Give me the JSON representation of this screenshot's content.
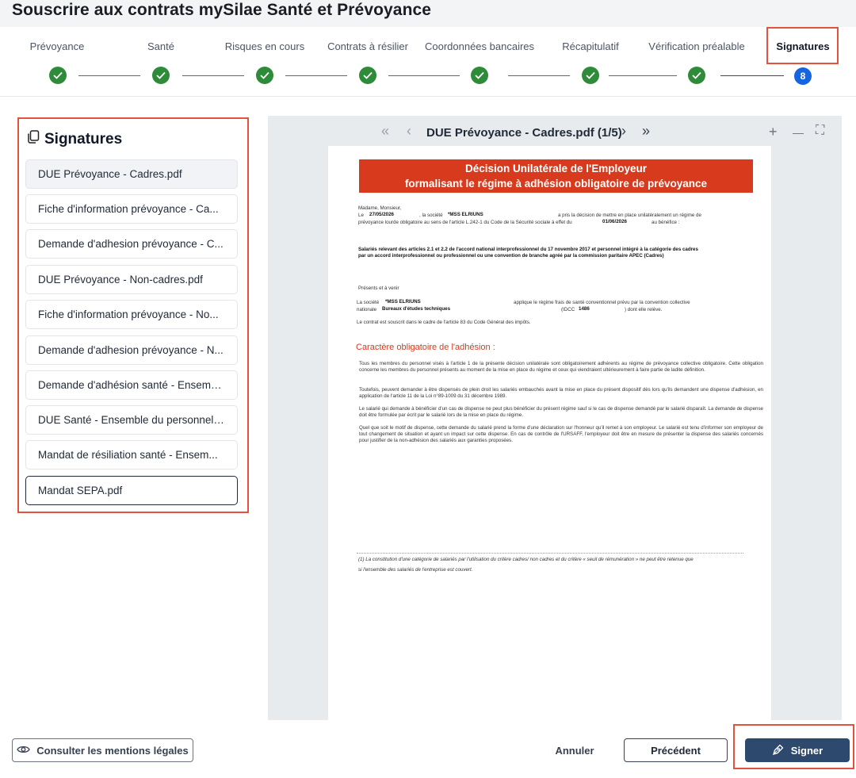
{
  "page_title": "Souscrire aux contrats mySilae Santé et Prévoyance",
  "stepper": {
    "steps": [
      {
        "label": "Prévoyance",
        "status": "done"
      },
      {
        "label": "Santé",
        "status": "done"
      },
      {
        "label": "Risques en cours",
        "status": "done"
      },
      {
        "label": "Contrats à résilier",
        "status": "done"
      },
      {
        "label": "Coordonnées bancaires",
        "status": "done"
      },
      {
        "label": "Récapitulatif",
        "status": "done"
      },
      {
        "label": "Vérification préalable",
        "status": "done"
      },
      {
        "label": "Signatures",
        "status": "active",
        "number": "8"
      }
    ]
  },
  "sidebar": {
    "title": "Signatures",
    "icon": "copy-icon",
    "documents": [
      "DUE Prévoyance - Cadres.pdf",
      "Fiche d'information prévoyance - Ca...",
      "Demande d'adhesion prévoyance - C...",
      "DUE Prévoyance - Non-cadres.pdf",
      "Fiche d'information prévoyance - No...",
      "Demande d'adhesion prévoyance - N...",
      "Demande d'adhésion santé - Ensemb...",
      "DUE Santé - Ensemble du personnel....",
      "Mandat de résiliation santé - Ensem...",
      "Mandat SEPA.pdf"
    ]
  },
  "viewer": {
    "title": "DUE Prévoyance - Cadres.pdf (1/5)",
    "first_icon": "«",
    "prev_icon": "‹",
    "next_icon": "›",
    "last_icon": "»",
    "zoom_in": "+",
    "zoom_out": "—",
    "fullscreen": "⛶"
  },
  "document": {
    "banner_line1": "Décision Unilatérale de l'Employeur",
    "banner_line2": "formalisant le régime à adhésion obligatoire de prévoyance",
    "salutation": "Madame, Monsieur,",
    "line_le": "Le",
    "date1": "27/05/2026",
    "la_societe": ", la société",
    "company": "*MSS ELRIUNS",
    "decision_text": "a pris la décision de mettre en place unilatéralement un régime de",
    "decision_text2": "prévoyance lourde obligatoire au sens de l'article L.242-1 du Code de la Sécurité sociale à effet du",
    "date2": "01/06/2026",
    "au_benefice": "au bénéfice :",
    "salaries_line1": "Salariés relevant des articles 2.1 et 2.2 de l'accord national interprofessionnel du 17 novembre 2017 et personnel intégré à la catégorie des cadres",
    "salaries_line2": "par un accord interprofessionnel ou professionnel ou une convention de branche agréé par la commission paritaire APEC (Cadres)",
    "presents": "Présents et à venir",
    "societe_label": "La société",
    "applique_text": "applique le régime frais de santé conventionnel prévu par la convention collective",
    "nationale": "nationale",
    "bureau": "Bureaux d'études techniques",
    "idcc_label": "(IDCC",
    "idcc": "1486",
    "releve": ") dont elle relève.",
    "contrat_text": "Le contrat est souscrit dans le cadre de l'article 83 du Code Général des impôts.",
    "caractere_title": "Caractère obligatoire de l'adhésion :",
    "para1": "Tous les membres du personnel visés à l'article 1 de la présente décision unilatérale sont obligatoirement adhérents au régime de prévoyance collective obligatoire. Cette obligation concerne les membres du personnel présents au moment de la mise en place du régime et ceux qui viendraient ultérieurement à faire partie de ladite définition.",
    "para2": "Toutefois, peuvent demander à être dispensés de plein droit les salariés embauchés avant la mise en place du présent dispositif dès lors qu'ils demandent une dispense d'adhésion, en application de l'article 11 de la Loi n°89-1009 du 31 décembre 1989.",
    "para3": "Le salarié qui demande à bénéficier d'un cas de dispense ne peut plus bénéficier du présent régime sauf si le cas de dispense demandé par le salarié disparaît. La demande de dispense doit être formulée par écrit par le salarié lors de la mise en place du régime.",
    "para4": "Quel que soit le motif de dispense, cette demande du salarié prend la forme d'une déclaration sur l'honneur qu'il remet à son employeur. Le salarié est tenu d'informer son employeur de tout changement de situation et ayant un impact sur cette dispense. En cas de contrôle de l'URSAFF, l'employeur doit être en mesure de présenter la dispense des salariés concernés pour justifier de la non-adhésion des salariés aux garanties proposées.",
    "footnote1": "(1) La constitution d'une catégorie de salariés par l'utilisation du critère cadres/ non cadres et du critère « seuil de rémunération » ne peut être retenue que",
    "footnote2": "si l'ensemble des salariés de l'entreprise est couvert."
  },
  "footer": {
    "legal_label": "Consulter les mentions légales",
    "cancel_label": "Annuler",
    "prev_label": "Précédent",
    "sign_label": "Signer"
  },
  "colors": {
    "accent_red": "#e2533d",
    "success_green": "#2e8b3a",
    "active_blue": "#1565e0",
    "sign_button": "#2d4a6e"
  }
}
